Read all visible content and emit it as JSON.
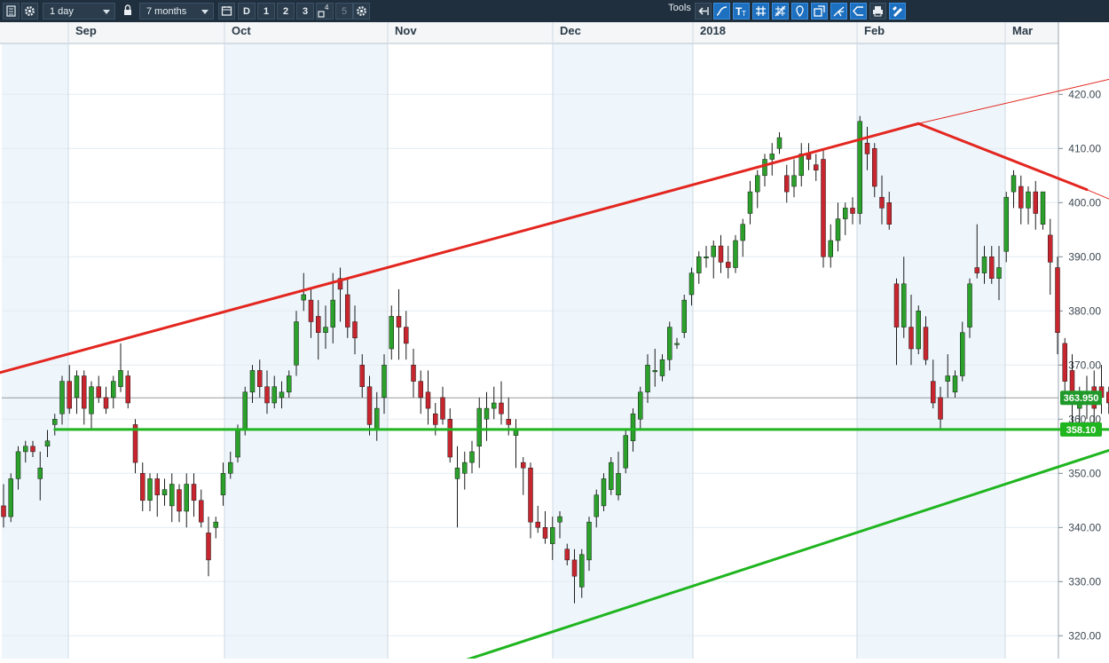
{
  "toolbar": {
    "interval": "1 day",
    "range": "7 months",
    "periods": [
      "D",
      "1",
      "2",
      "3",
      "4",
      "5"
    ],
    "tools_label": "Tools"
  },
  "colors": {
    "up": "#2ba02b",
    "down": "#c8262f",
    "resistance": "#e3261f",
    "support": "#1fb51f",
    "shade": "#eef6fc",
    "last_price_bg": "#1f9a2a"
  },
  "icons": [
    "menu-icon",
    "settings-icon",
    "lock-icon",
    "calendar-icon",
    "layout-icon",
    "settings-icon",
    "undo-icon",
    "curve-icon",
    "text-tool-icon",
    "grid-icon",
    "crosshair-icon",
    "marker-icon",
    "fullscreen-icon",
    "fork-icon",
    "callout-icon",
    "print-icon",
    "pen-icon"
  ],
  "chart_data": {
    "type": "candlestick",
    "x_labels": [
      "Sep",
      "Oct",
      "Nov",
      "Dec",
      "2018",
      "Feb",
      "Mar"
    ],
    "y_ticks": [
      320,
      330,
      340,
      350,
      360,
      370,
      380,
      390,
      400,
      410,
      420
    ],
    "y_tick_labels": [
      "320.00",
      "330.00",
      "340.00",
      "350.00",
      "360.00",
      "370.00",
      "380.00",
      "390.00",
      "400.00",
      "410.00",
      "420.00"
    ],
    "last_price": "363.950",
    "support_level": "358.10",
    "candles": [
      [
        344,
        348,
        340,
        342
      ],
      [
        342,
        350,
        341,
        349
      ],
      [
        349,
        355,
        347,
        354
      ],
      [
        354,
        356,
        352,
        355
      ],
      [
        355,
        356,
        353,
        354
      ],
      [
        349,
        354,
        345,
        351
      ],
      [
        355,
        358,
        353,
        356
      ],
      [
        359,
        361,
        357,
        360
      ],
      [
        361,
        368,
        359,
        367
      ],
      [
        367,
        370,
        361,
        362
      ],
      [
        364,
        369,
        361,
        368
      ],
      [
        368,
        369,
        359,
        362
      ],
      [
        361,
        367,
        358,
        366
      ],
      [
        366,
        368,
        363,
        364
      ],
      [
        364,
        366,
        361,
        362
      ],
      [
        364,
        368,
        362,
        367
      ],
      [
        366,
        374,
        365,
        369
      ],
      [
        368,
        369,
        362,
        363
      ],
      [
        359,
        360,
        350,
        352
      ],
      [
        350,
        352,
        343,
        345
      ],
      [
        345,
        350,
        343,
        349
      ],
      [
        349,
        350,
        342,
        346
      ],
      [
        346,
        349,
        344,
        347
      ],
      [
        344,
        350,
        341,
        348
      ],
      [
        347,
        348,
        341,
        343
      ],
      [
        343,
        350,
        340,
        348
      ],
      [
        348,
        350,
        342,
        345
      ],
      [
        345,
        347,
        340,
        341
      ],
      [
        339,
        342,
        331,
        334
      ],
      [
        340,
        342,
        338,
        341
      ],
      [
        346,
        352,
        344,
        350
      ],
      [
        350,
        354,
        349,
        352
      ],
      [
        353,
        359,
        352,
        358
      ],
      [
        358,
        366,
        357,
        365
      ],
      [
        365,
        370,
        363,
        369
      ],
      [
        369,
        371,
        364,
        366
      ],
      [
        366,
        369,
        361,
        363
      ],
      [
        363,
        368,
        362,
        366
      ],
      [
        364,
        367,
        362,
        365
      ],
      [
        365,
        369,
        364,
        368
      ],
      [
        370,
        380,
        368,
        378
      ],
      [
        382,
        387,
        380,
        383
      ],
      [
        382,
        384,
        375,
        378
      ],
      [
        379,
        382,
        371,
        376
      ],
      [
        376,
        381,
        373,
        377
      ],
      [
        377,
        387,
        374,
        382
      ],
      [
        386,
        388,
        378,
        384
      ],
      [
        383,
        386,
        375,
        377
      ],
      [
        378,
        381,
        372,
        375
      ],
      [
        370,
        372,
        364,
        366
      ],
      [
        366,
        368,
        357,
        359
      ],
      [
        358,
        365,
        356,
        362
      ],
      [
        364,
        372,
        361,
        370
      ],
      [
        373,
        381,
        371,
        379
      ],
      [
        379,
        384,
        371,
        377
      ],
      [
        377,
        380,
        371,
        374
      ],
      [
        370,
        373,
        364,
        367
      ],
      [
        367,
        369,
        361,
        364
      ],
      [
        365,
        369,
        359,
        362
      ],
      [
        361,
        363,
        357,
        359
      ],
      [
        364,
        366,
        359,
        360
      ],
      [
        360,
        362,
        352,
        353
      ],
      [
        349,
        355,
        340,
        351
      ],
      [
        350,
        354,
        347,
        352
      ],
      [
        352,
        356,
        350,
        354
      ],
      [
        355,
        364,
        351,
        362
      ],
      [
        360,
        365,
        356,
        362
      ],
      [
        362,
        366,
        360,
        363
      ],
      [
        363,
        367,
        359,
        361
      ],
      [
        360,
        364,
        357,
        359
      ],
      [
        357,
        360,
        351,
        358
      ],
      [
        352,
        353,
        346,
        351
      ],
      [
        351,
        352,
        338,
        341
      ],
      [
        341,
        344,
        339,
        340
      ],
      [
        340,
        343,
        337,
        338
      ],
      [
        337,
        342,
        334,
        340
      ],
      [
        341,
        343,
        338,
        342
      ],
      [
        336,
        337,
        333,
        334
      ],
      [
        334,
        336,
        326,
        331
      ],
      [
        329,
        336,
        327,
        335
      ],
      [
        334,
        342,
        332,
        341
      ],
      [
        342,
        347,
        340,
        346
      ],
      [
        344,
        350,
        343,
        349
      ],
      [
        347,
        353,
        346,
        352
      ],
      [
        346,
        354,
        345,
        350
      ],
      [
        351,
        358,
        350,
        357
      ],
      [
        356,
        362,
        354,
        361
      ],
      [
        360,
        366,
        358,
        365
      ],
      [
        365,
        372,
        363,
        370
      ],
      [
        369,
        373,
        366,
        369
      ],
      [
        368,
        372,
        367,
        371
      ],
      [
        371,
        378,
        369,
        377
      ],
      [
        374,
        375,
        373,
        374
      ],
      [
        376,
        383,
        375,
        382
      ],
      [
        383,
        388,
        381,
        387
      ],
      [
        387,
        391,
        385,
        390
      ],
      [
        390,
        392,
        388,
        390
      ],
      [
        390,
        393,
        386,
        392
      ],
      [
        392,
        394,
        387,
        389
      ],
      [
        389,
        392,
        386,
        388
      ],
      [
        388,
        394,
        387,
        393
      ],
      [
        393,
        397,
        390,
        396
      ],
      [
        398,
        404,
        396,
        402
      ],
      [
        402,
        406,
        399,
        405
      ],
      [
        405,
        409,
        403,
        408
      ],
      [
        408,
        411,
        405,
        409
      ],
      [
        410,
        413,
        409,
        412
      ],
      [
        405,
        407,
        400,
        402
      ],
      [
        403,
        408,
        401,
        405
      ],
      [
        405,
        411,
        403,
        409
      ],
      [
        409,
        411,
        406,
        408
      ],
      [
        407,
        409,
        404,
        406
      ],
      [
        408,
        410,
        388,
        390
      ],
      [
        390,
        396,
        388,
        393
      ],
      [
        393,
        400,
        391,
        397
      ],
      [
        397,
        400,
        394,
        399
      ],
      [
        399,
        401,
        396,
        398
      ],
      [
        398,
        416,
        396,
        415
      ],
      [
        411,
        414,
        406,
        409
      ],
      [
        410,
        411,
        401,
        403
      ],
      [
        401,
        405,
        396,
        399
      ],
      [
        400,
        402,
        395,
        396
      ],
      [
        385,
        386,
        370,
        377
      ],
      [
        377,
        390,
        375,
        385
      ],
      [
        377,
        383,
        370,
        373
      ],
      [
        373,
        381,
        372,
        380
      ],
      [
        377,
        379,
        370,
        371
      ],
      [
        367,
        371,
        362,
        363
      ],
      [
        364,
        366,
        358,
        360
      ],
      [
        367,
        372,
        364,
        368
      ],
      [
        365,
        369,
        364,
        368
      ],
      [
        368,
        378,
        367,
        376
      ],
      [
        377,
        386,
        375,
        385
      ],
      [
        388,
        396,
        386,
        387
      ],
      [
        387,
        392,
        385,
        390
      ],
      [
        390,
        392,
        385,
        386
      ],
      [
        386,
        392,
        382,
        388
      ],
      [
        391,
        402,
        389,
        401
      ],
      [
        402,
        406,
        399,
        405
      ],
      [
        403,
        405,
        396,
        399
      ],
      [
        399,
        403,
        396,
        402
      ],
      [
        402,
        404,
        395,
        398
      ],
      [
        396,
        402,
        395,
        402
      ],
      [
        394,
        397,
        383,
        389
      ],
      [
        388,
        390,
        372,
        376
      ],
      [
        374,
        375,
        364,
        367
      ],
      [
        369,
        372,
        358,
        363
      ],
      [
        362,
        366,
        357,
        364
      ],
      [
        364,
        368,
        360,
        365
      ],
      [
        366,
        369,
        359,
        362
      ],
      [
        366,
        370,
        361,
        364
      ],
      [
        365,
        366,
        361,
        363
      ]
    ],
    "trendlines": [
      {
        "name": "upper-resistance",
        "from": [
          -0.5,
          368.6
        ],
        "to": [
          125,
          414.6
        ],
        "color": "resistance",
        "width": 3
      },
      {
        "name": "upper-resistance-ext",
        "from": [
          125,
          414.6
        ],
        "to": [
          160,
          425.6
        ],
        "color": "resistance",
        "width": 1
      },
      {
        "name": "descending-resistance",
        "from": [
          125,
          414.6
        ],
        "to": [
          148,
          402.4
        ],
        "color": "resistance",
        "width": 3
      },
      {
        "name": "descending-resistance-ext",
        "from": [
          148,
          402.4
        ],
        "to": [
          160,
          395.6
        ],
        "color": "resistance",
        "width": 1
      },
      {
        "name": "support-rising",
        "from": [
          52,
          310.6
        ],
        "to": [
          160,
          358.2
        ],
        "color": "support",
        "width": 3
      },
      {
        "name": "support-horizontal",
        "from": [
          7,
          358.1
        ],
        "to": [
          160,
          358.1
        ],
        "color": "support",
        "width": 3
      }
    ]
  }
}
